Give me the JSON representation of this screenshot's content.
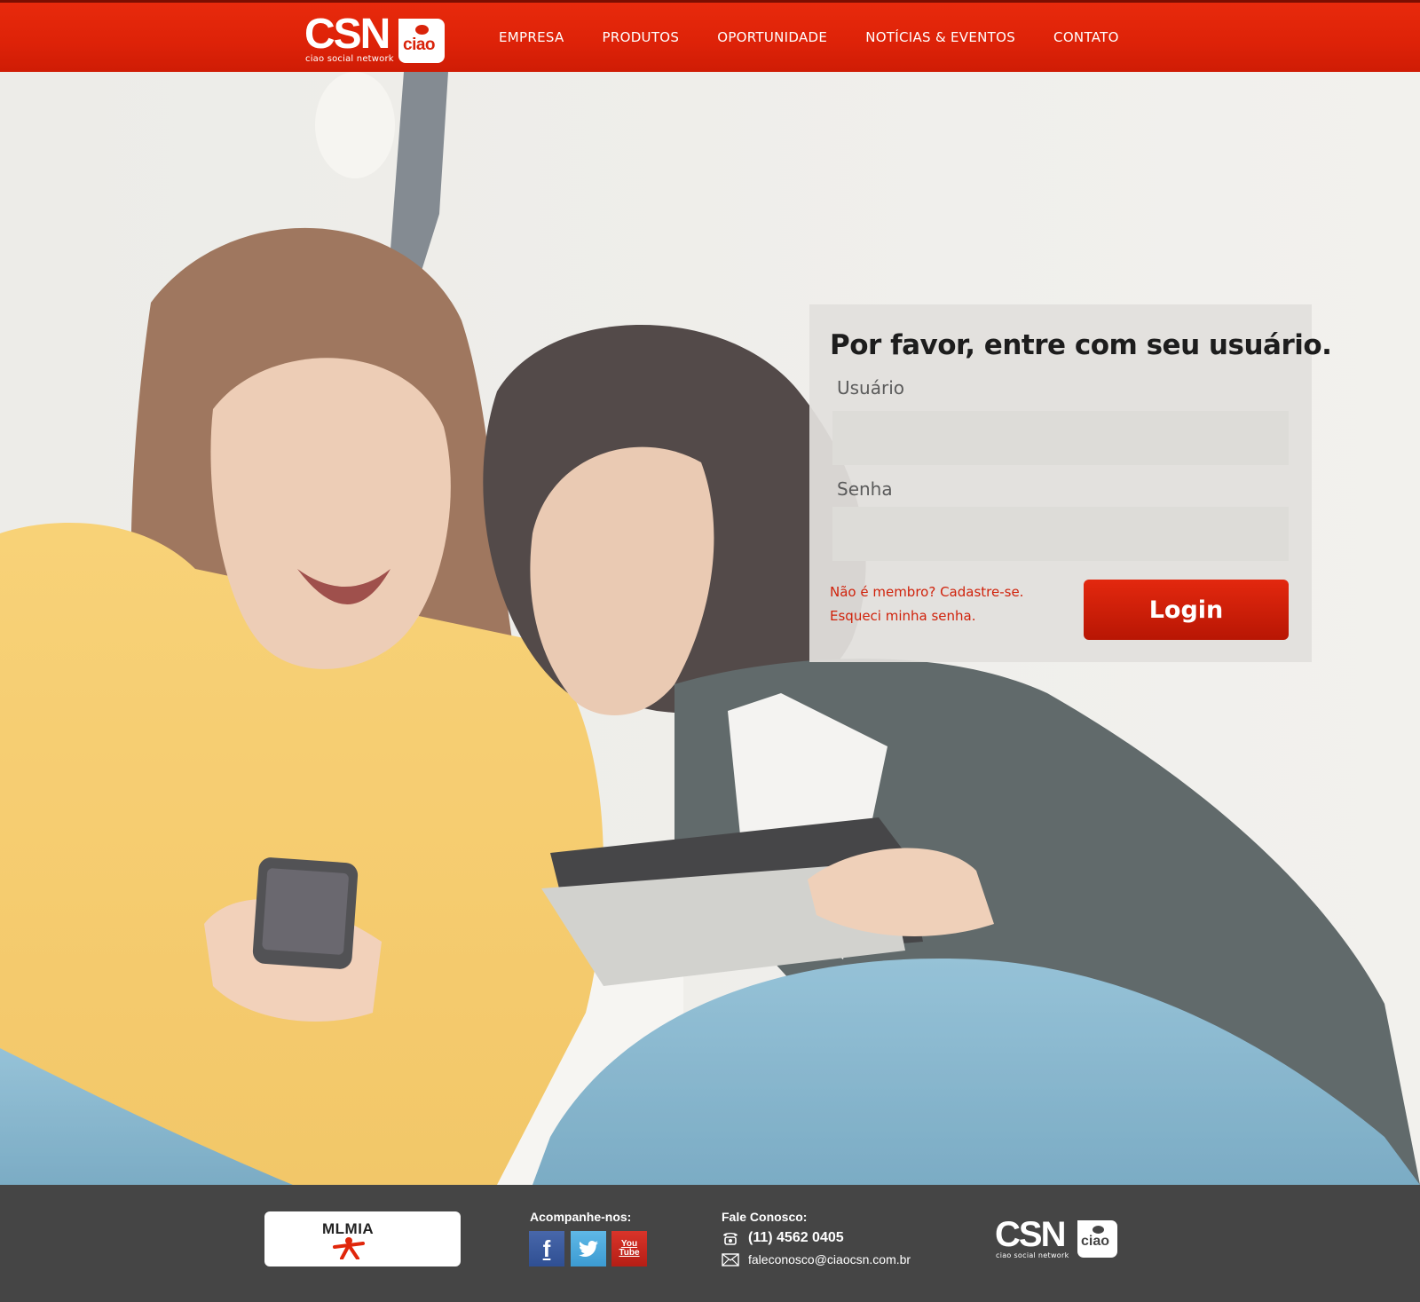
{
  "header": {
    "logo": {
      "main": "CSN",
      "badge": "ciao",
      "tagline": "ciao social network"
    },
    "nav": [
      "EMPRESA",
      "PRODUTOS",
      "OPORTUNIDADE",
      "NOTÍCIAS & EVENTOS",
      "CONTATO"
    ]
  },
  "login": {
    "title": "Por favor, entre com seu usuário.",
    "username_label": "Usuário",
    "username_value": "",
    "password_label": "Senha",
    "password_value": "",
    "signup_link": "Não é membro? Cadastre-se.",
    "forgot_link": "Esqueci minha senha.",
    "login_button": "Login"
  },
  "footer": {
    "partner_logo": "MLMIA",
    "follow_label": "Acompanhe-nos:",
    "social": [
      {
        "name": "facebook-icon",
        "glyph": "f",
        "color": "#3b5998"
      },
      {
        "name": "twitter-icon",
        "glyph": "t",
        "color": "#4aa8dd"
      },
      {
        "name": "youtube-icon",
        "glyph": "You Tube",
        "color": "#c4271d"
      }
    ],
    "contact_label": "Fale Conosco:",
    "phone": "(11) 4562 0405",
    "email": "faleconosco@ciaocsn.com.br",
    "logo": {
      "main": "CSN",
      "badge": "ciao",
      "tagline": "ciao social network"
    }
  },
  "colors": {
    "brand_red": "#e0260b",
    "footer_bg": "#454545",
    "panel_bg": "#e2e0dd",
    "link_red": "#d0220b"
  }
}
